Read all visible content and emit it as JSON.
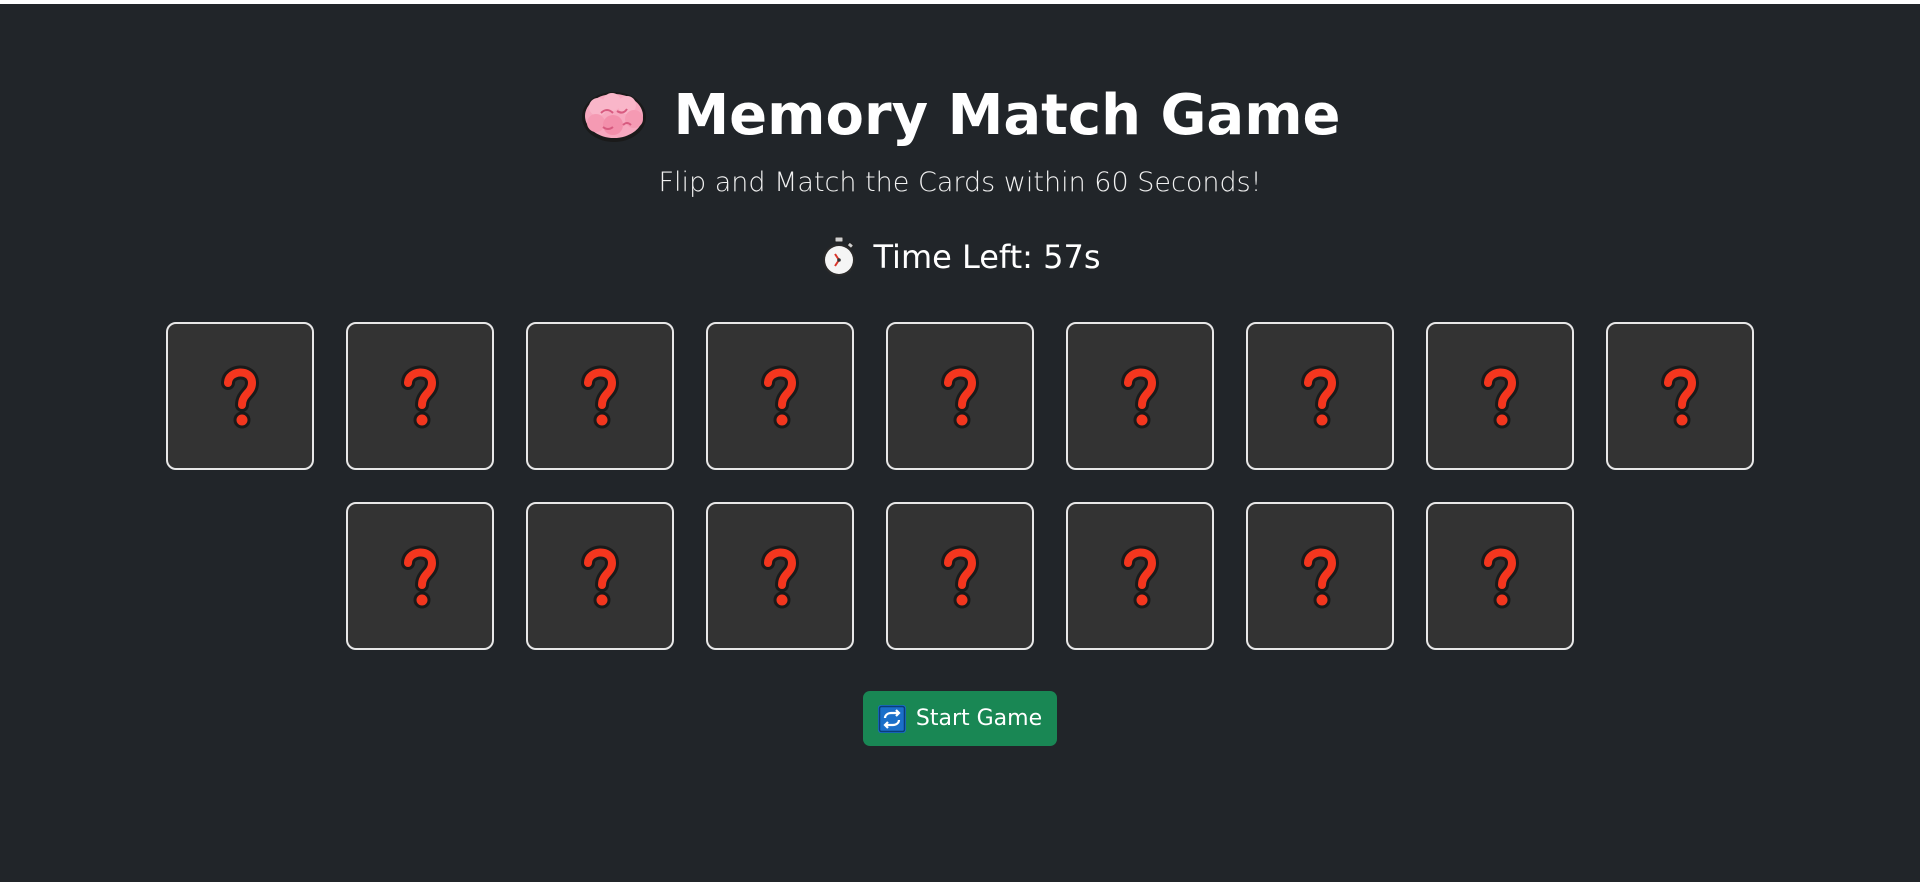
{
  "header": {
    "title": "Memory Match Game",
    "title_icon": "brain-icon",
    "subtitle": "Flip and Match the Cards within 60 Seconds!"
  },
  "timer": {
    "icon": "stopwatch-icon",
    "text": "Time Left: 57s"
  },
  "board": {
    "card_back_icon": "question-mark-icon",
    "cards": [
      {
        "state": "face-down"
      },
      {
        "state": "face-down"
      },
      {
        "state": "face-down"
      },
      {
        "state": "face-down"
      },
      {
        "state": "face-down"
      },
      {
        "state": "face-down"
      },
      {
        "state": "face-down"
      },
      {
        "state": "face-down"
      },
      {
        "state": "face-down"
      },
      {
        "state": "face-down"
      },
      {
        "state": "face-down"
      },
      {
        "state": "face-down"
      },
      {
        "state": "face-down"
      },
      {
        "state": "face-down"
      },
      {
        "state": "face-down"
      },
      {
        "state": "face-down"
      }
    ]
  },
  "controls": {
    "start_label": "Start Game",
    "start_icon": "repeat-icon"
  },
  "colors": {
    "background": "#212529",
    "card_bg": "#333333",
    "card_border": "#e8e8e8",
    "question_mark": "#f4361e",
    "button": "#198754"
  }
}
